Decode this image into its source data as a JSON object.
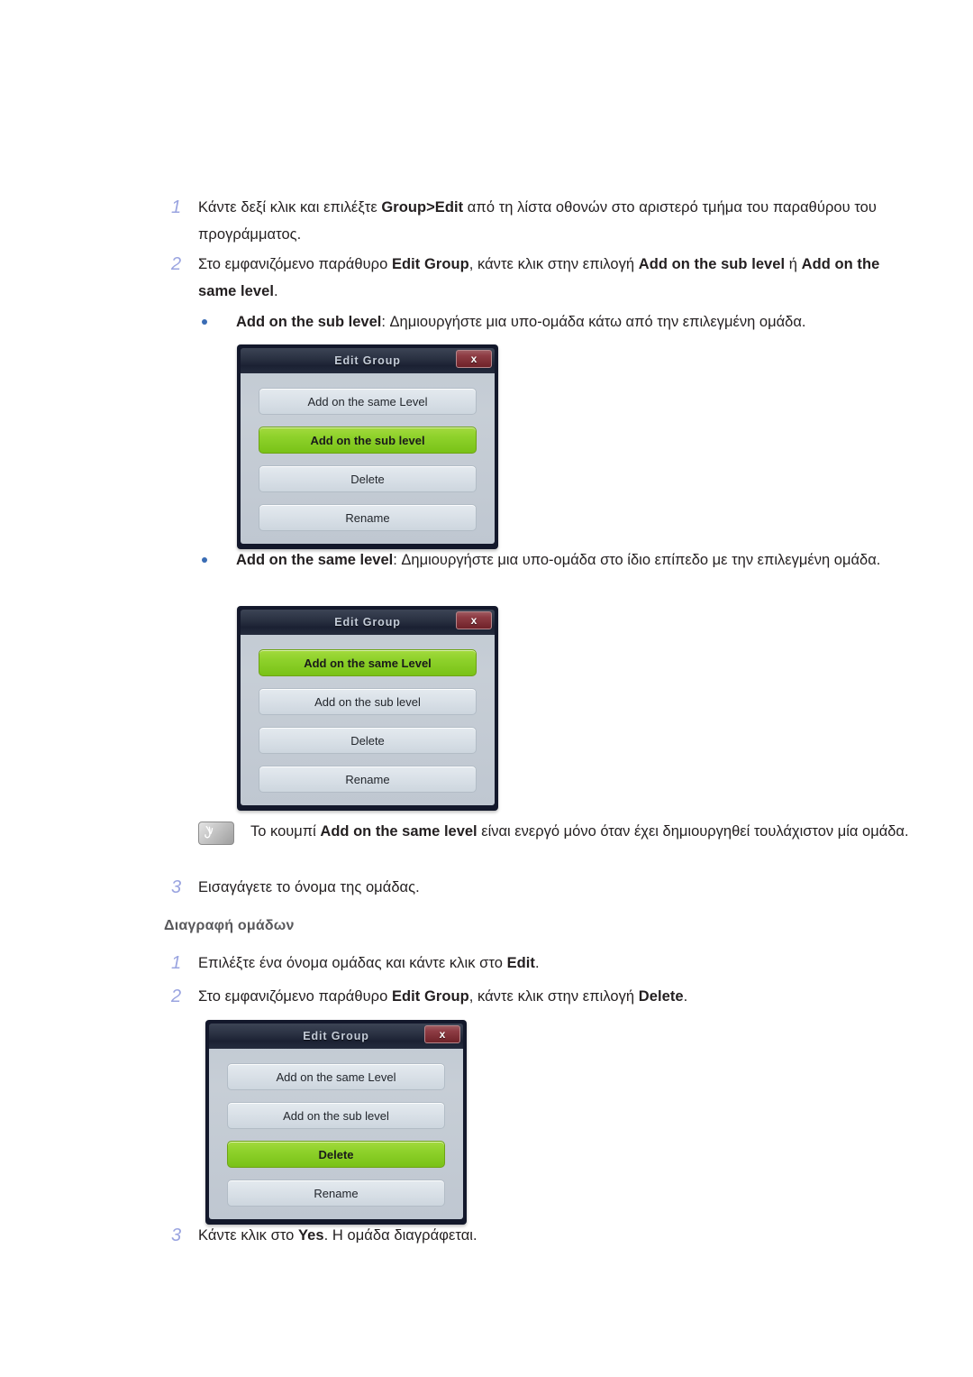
{
  "steps": [
    {
      "id": "step-1-top",
      "number": "1",
      "html": "Κάντε δεξί κλικ και επιλέξτε <b>Group&gt;Edit</b> από τη λίστα οθονών στο αριστερό τμήμα του παραθύρου του προγράμματος."
    },
    {
      "id": "step-2-top",
      "number": "2",
      "html": "Στο εμφανιζόμενο παράθυρο <b>Edit Group</b>, κάντε κλικ στην επιλογή <b>Add on the sub level</b> ή <b>Add on the same level</b>."
    },
    {
      "id": "step-3-top",
      "number": "3",
      "html": "Εισαγάγετε το όνομα της ομάδας."
    },
    {
      "id": "step-1-delete",
      "number": "1",
      "html": "Επιλέξτε ένα όνομα ομάδας και κάντε κλικ στο <b>Edit</b>."
    },
    {
      "id": "step-2-delete",
      "number": "2",
      "html": "Στο εμφανιζόμενο παράθυρο <b>Edit Group</b>, κάντε κλικ στην επιλογή <b>Delete</b>."
    },
    {
      "id": "step-3-delete",
      "number": "3",
      "html": "Κάντε κλικ στο <b>Yes</b>. Η ομάδα διαγράφεται."
    }
  ],
  "bullets": [
    {
      "id": "bullet-sub-level",
      "html": "<b>Add on the sub level</b>: Δημιουργήστε μια υπο-ομάδα κάτω από την επιλεγμένη ομάδα."
    },
    {
      "id": "bullet-same-level",
      "html": "<b>Add on the same level</b>: Δημιουργήστε μια υπο-ομάδα στο ίδιο επίπεδο με την επιλεγμένη ομάδα."
    }
  ],
  "note": {
    "icon": "note-pen-icon",
    "html": "Το κουμπί <b>Add on the same level</b> είναι ενεργό μόνο όταν έχει δημιουργηθεί τουλάχιστον μία ομάδα."
  },
  "section_heading": "Διαγραφή ομάδων",
  "dialogs": [
    {
      "id": "dialog-sub-level",
      "title": "Edit Group",
      "close_label": "x",
      "buttons": [
        {
          "label": "Add on the same Level",
          "highlighted": false
        },
        {
          "label": "Add on the sub level",
          "highlighted": true
        },
        {
          "label": "Delete",
          "highlighted": false
        },
        {
          "label": "Rename",
          "highlighted": false
        }
      ]
    },
    {
      "id": "dialog-same-level",
      "title": "Edit Group",
      "close_label": "x",
      "buttons": [
        {
          "label": "Add on the same Level",
          "highlighted": true
        },
        {
          "label": "Add on the sub level",
          "highlighted": false
        },
        {
          "label": "Delete",
          "highlighted": false
        },
        {
          "label": "Rename",
          "highlighted": false
        }
      ]
    },
    {
      "id": "dialog-delete",
      "title": "Edit Group",
      "close_label": "x",
      "buttons": [
        {
          "label": "Add on the same Level",
          "highlighted": false
        },
        {
          "label": "Add on the sub level",
          "highlighted": false
        },
        {
          "label": "Delete",
          "highlighted": true
        },
        {
          "label": "Rename",
          "highlighted": false
        }
      ]
    }
  ],
  "colors": {
    "step_number": "#9aa4e0",
    "bullet": "#3a6cb4",
    "heading": "#58585b",
    "highlight_green": "#8fd22c",
    "close_red": "#8e3c44",
    "dialog_frame": "#13182b",
    "dialog_body": "#c3cbd4"
  }
}
